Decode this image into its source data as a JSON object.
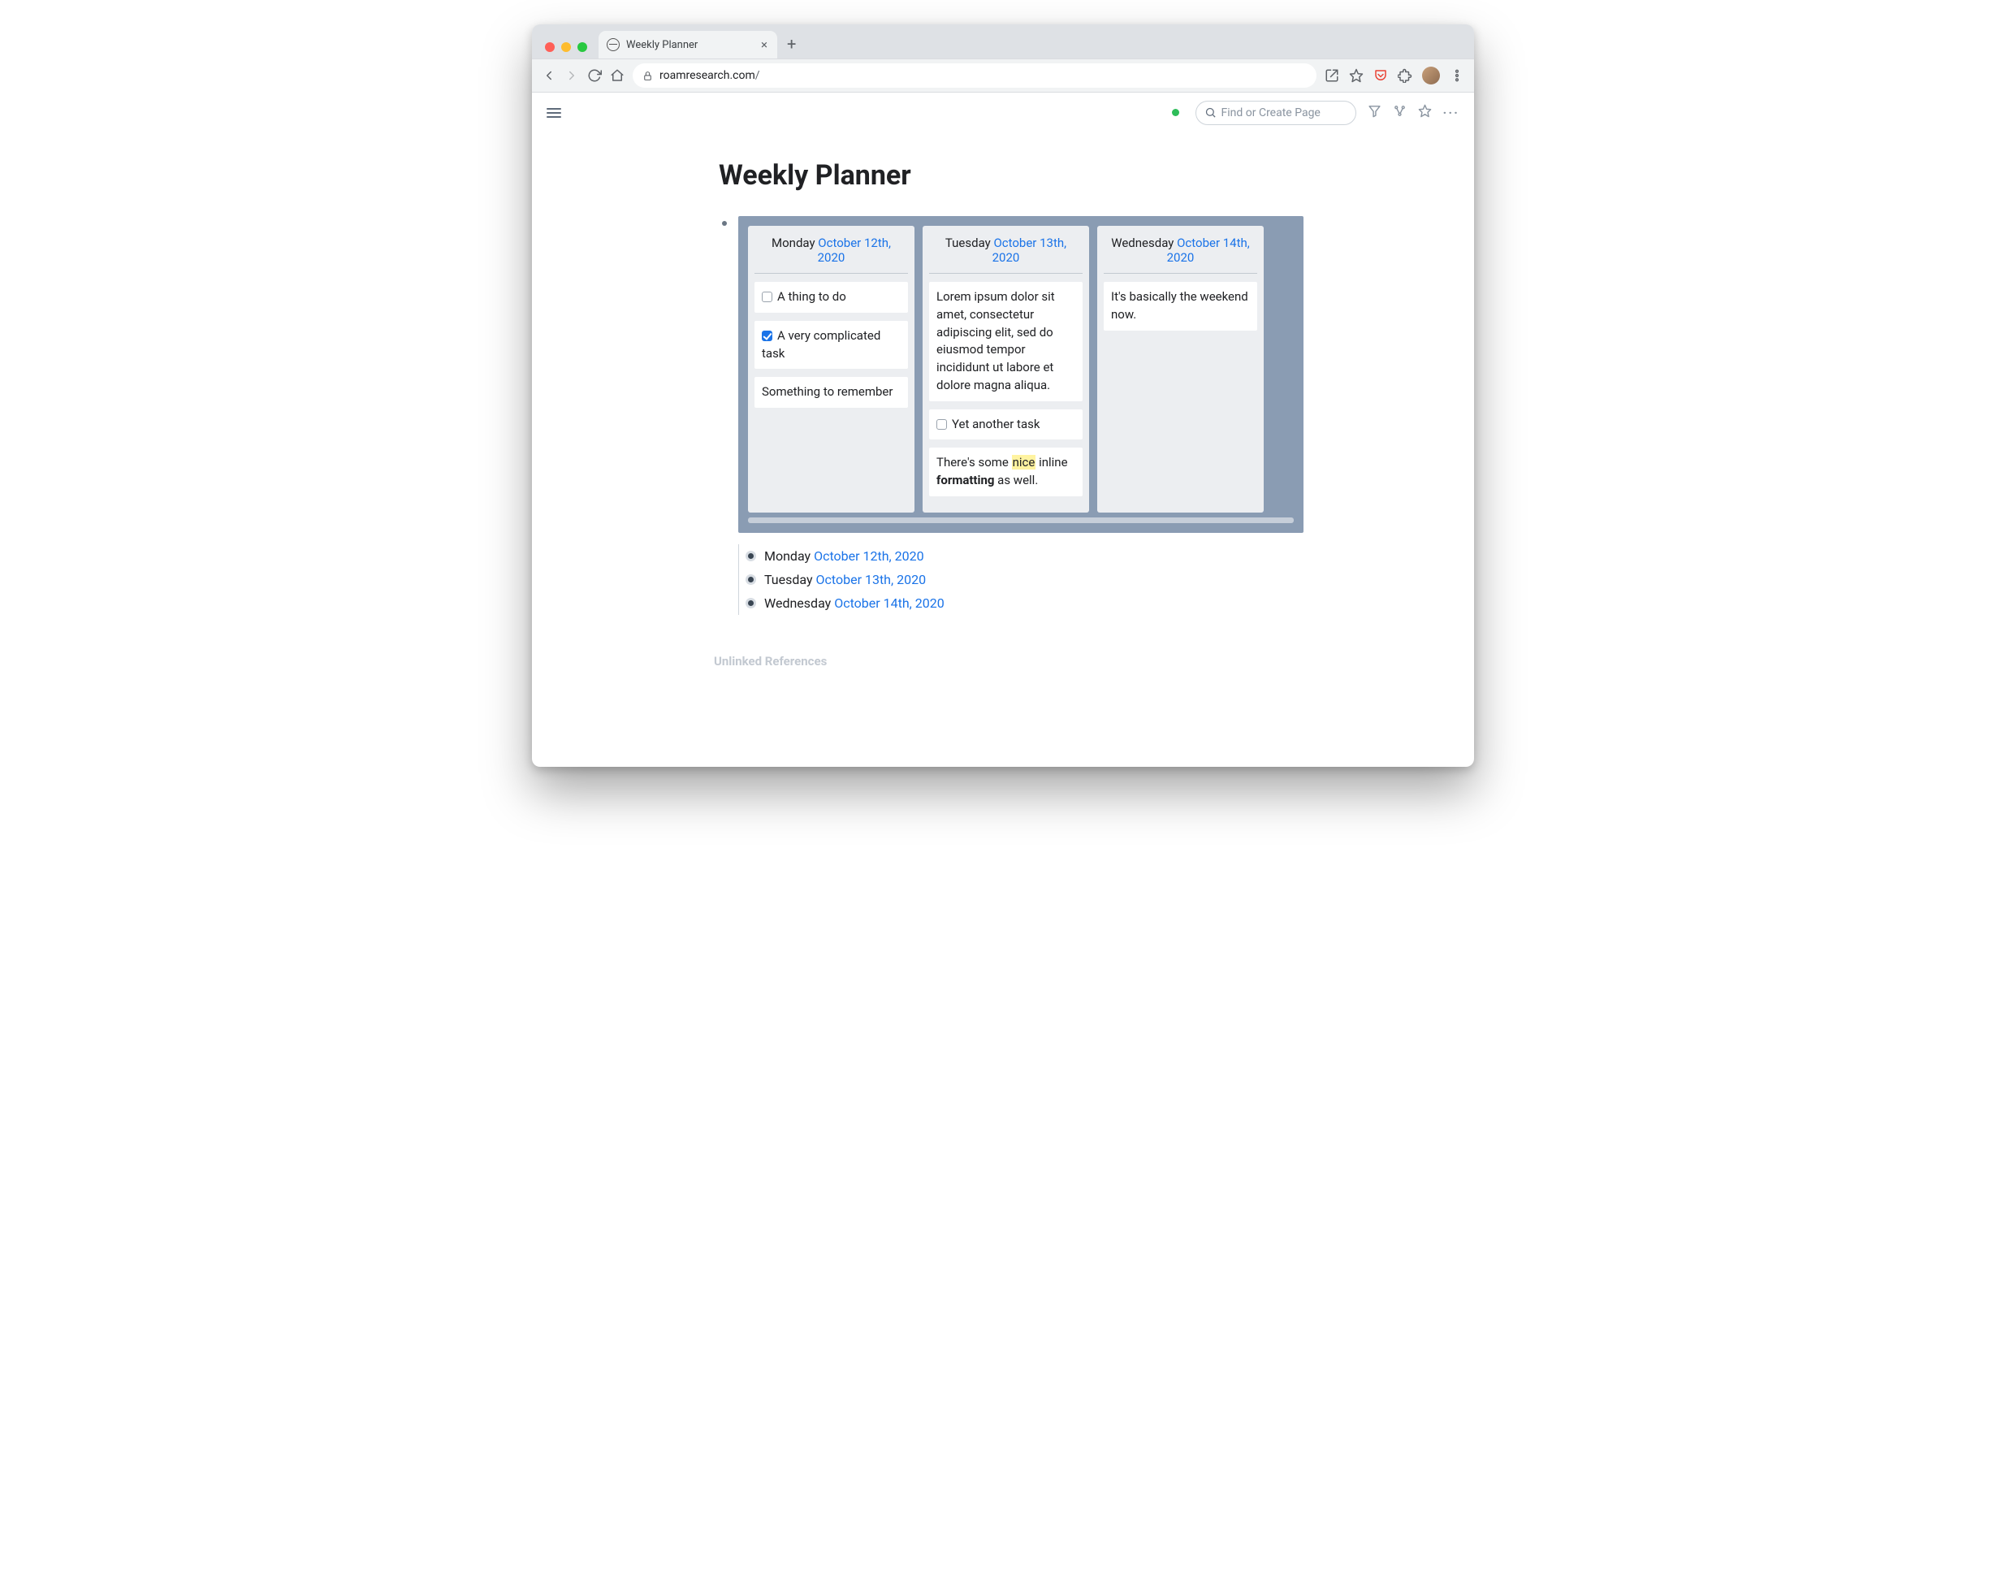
{
  "browser": {
    "tab_title": "Weekly Planner",
    "url_host": "roamresearch.com",
    "url_path": "/"
  },
  "app": {
    "search_placeholder": "Find or Create Page"
  },
  "page": {
    "title": "Weekly Planner",
    "unlinked_label": "Unlinked References"
  },
  "board": {
    "columns": [
      {
        "day": "Monday",
        "date": "October 12th, 2020",
        "cards": [
          {
            "type": "todo",
            "checked": false,
            "text": "A thing to do"
          },
          {
            "type": "todo",
            "checked": true,
            "text": "A very complicated task"
          },
          {
            "type": "note",
            "text": "Something to remember"
          }
        ]
      },
      {
        "day": "Tuesday",
        "date": "October 13th, 2020",
        "cards": [
          {
            "type": "note",
            "text": "Lorem ipsum dolor sit amet, consectetur adipiscing elit, sed do eiusmod tempor incididunt ut labore et dolore magna aliqua."
          },
          {
            "type": "todo",
            "checked": false,
            "text": "Yet another task"
          },
          {
            "type": "rich",
            "pre": "There's some ",
            "hl": "nice",
            "mid": " inline ",
            "bold": "formatting",
            "post": " as well."
          }
        ]
      },
      {
        "day": "Wednesday",
        "date": "October 14th, 2020",
        "cards": [
          {
            "type": "note",
            "text": "It's basically the weekend now."
          }
        ]
      }
    ]
  },
  "bullets": [
    {
      "day": "Monday",
      "date": "October 12th, 2020"
    },
    {
      "day": "Tuesday",
      "date": "October 13th, 2020"
    },
    {
      "day": "Wednesday",
      "date": "October 14th, 2020"
    }
  ]
}
